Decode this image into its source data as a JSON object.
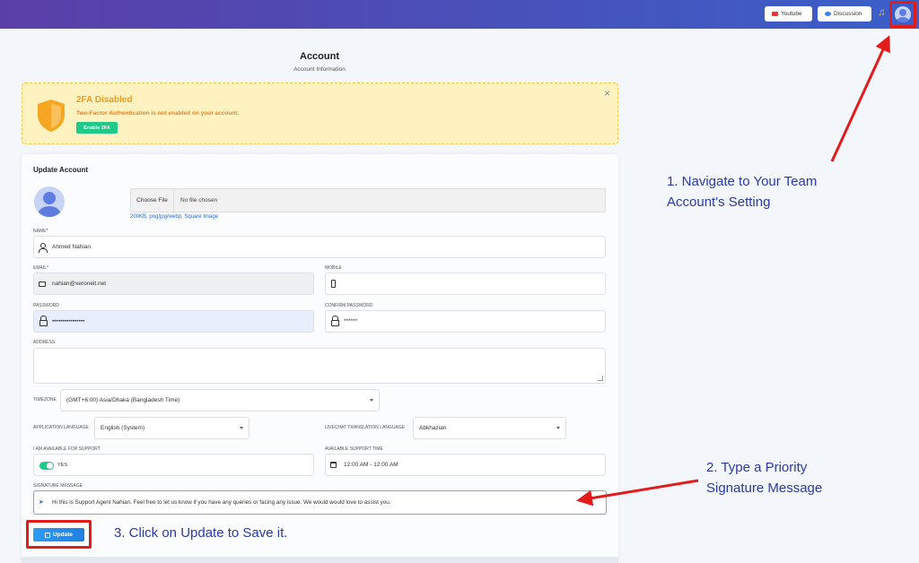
{
  "topbar": {
    "youtube_label": "Youtube",
    "discussion_label": "Discussion"
  },
  "page": {
    "title": "Account",
    "subtitle": "Account Information"
  },
  "alert": {
    "title": "2FA Disabled",
    "text": "Two-Factor Authentication is not enabled on your account.",
    "button_label": "Enable 2FA",
    "close_glyph": "×"
  },
  "form": {
    "title": "Update Account",
    "file": {
      "choose_label": "Choose File",
      "status": "No file chosen",
      "hint": "200KB, png/jpg/webp, Square Image"
    },
    "name": {
      "label": "NAME*",
      "value": "Ahmed Nahian"
    },
    "email": {
      "label": "EMAIL*",
      "value": "nahian@xeroneit.net"
    },
    "mobile": {
      "label": "MOBILE",
      "value": ""
    },
    "password": {
      "label": "PASSWORD",
      "value": "••••••••••••••••"
    },
    "confirm_password": {
      "label": "CONFIRM PASSWORD",
      "value": "******"
    },
    "address": {
      "label": "ADDRESS",
      "value": ""
    },
    "timezone": {
      "label": "TIMEZONE",
      "value": "(GMT+6:00) Asia/Dhaka (Bangladesh Time)"
    },
    "app_language": {
      "label": "APPLICATION LANGUAGE",
      "value": "English (System)"
    },
    "livechat_language": {
      "label": "LIVECHAT TRANSLATION LANGUAGE",
      "value": "Abkhazian"
    },
    "available": {
      "label": "I AM AVAILABLE FOR SUPPORT",
      "value": "YES"
    },
    "support_time": {
      "label": "AVAILABLE SUPPORT TIME",
      "value": "12:00 AM - 12:00 AM"
    },
    "signature": {
      "label": "SIGNATURE MESSAGE",
      "value": "Hi this is Support Agent Nahian. Feel free to let us know if you have any queries or facing any issue. We would would love to assist you."
    },
    "update_label": "Update"
  },
  "annotations": {
    "step1_line1": "1. Navigate to Your Team",
    "step1_line2": "Account's Setting",
    "step2_line1": "2. Type a Priority",
    "step2_line2": "Signature Message",
    "step3": "3. Click on Update to Save it."
  },
  "colors": {
    "topbar_start": "#5b3fa8",
    "topbar_end": "#3b5fc9",
    "highlight_red": "#e21b1b",
    "annotation_blue": "#2a3aa5",
    "enable_green": "#1fc987",
    "update_blue": "#1f7fe0"
  },
  "icons": {
    "top_avatar": "user-avatar-icon",
    "bell": "notification-bell-icon",
    "shield": "shield-icon",
    "user": "user-icon",
    "mail": "mail-icon",
    "phone": "phone-icon",
    "lock": "lock-icon",
    "calendar": "calendar-icon",
    "send": "send-icon",
    "edit": "edit-icon"
  }
}
